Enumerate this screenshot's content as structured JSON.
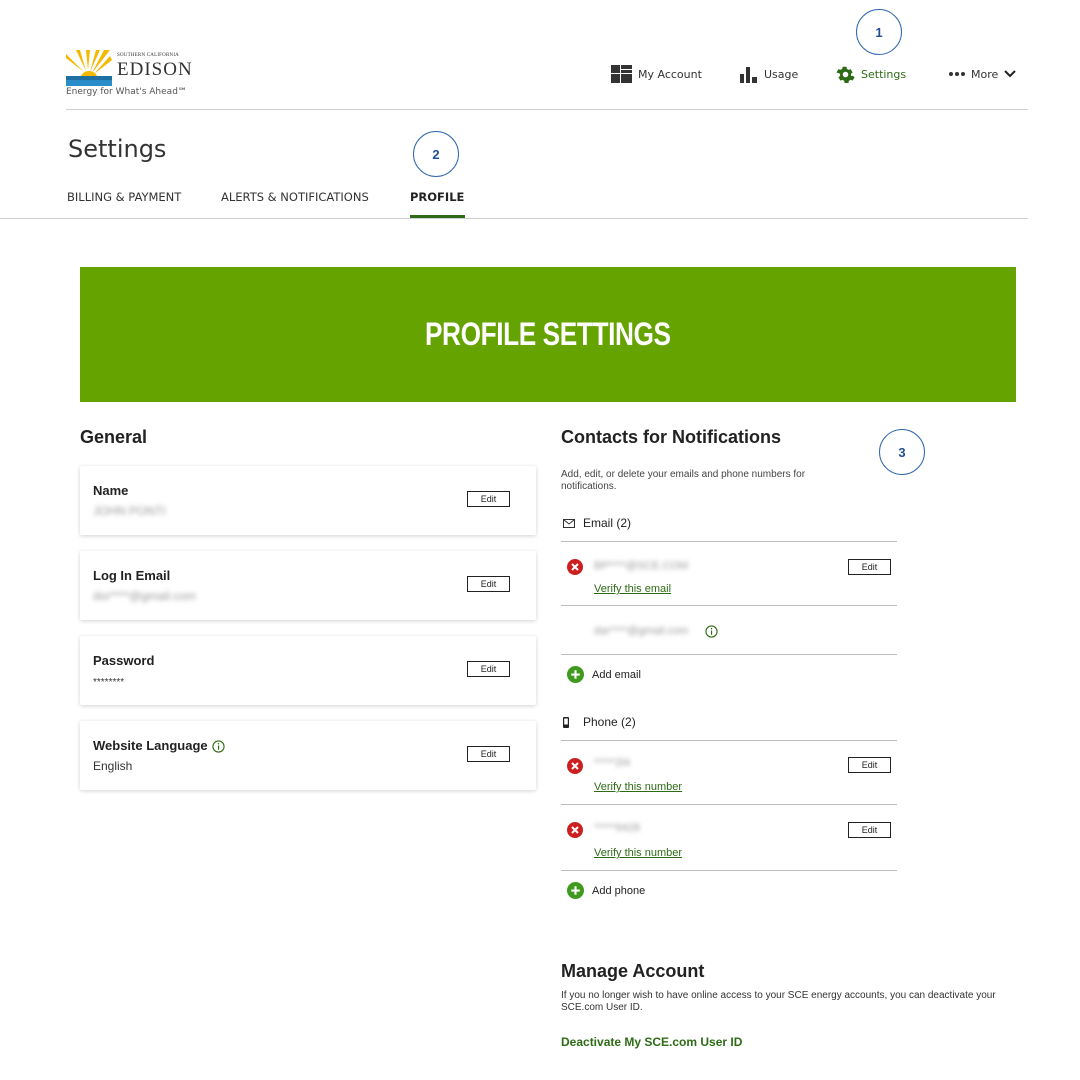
{
  "brand": {
    "small_text": "SOUTHERN CALIFORNIA",
    "name": "EDISON",
    "tagline": "Energy for What's Ahead℠",
    "colors": {
      "green": "#64a300",
      "dark_green": "#2e6b16",
      "yellow": "#f5b800",
      "callout_blue": "#2f67b1",
      "error_red": "#cc1f1f"
    }
  },
  "nav": [
    {
      "label": "My Account",
      "icon": "grid-icon"
    },
    {
      "label": "Usage",
      "icon": "bar-chart-icon"
    },
    {
      "label": "Settings",
      "icon": "gear-icon",
      "active": true
    },
    {
      "label": "More",
      "icon": "dots-icon"
    }
  ],
  "callouts": [
    "1",
    "2",
    "3"
  ],
  "page": {
    "title": "Settings",
    "tabs": [
      "BILLING & PAYMENT",
      "ALERTS & NOTIFICATIONS",
      "PROFILE"
    ],
    "active_tab": "PROFILE"
  },
  "banner": {
    "title": "PROFILE SETTINGS"
  },
  "general": {
    "title": "General",
    "edit_label": "Edit",
    "cards": [
      {
        "label": "Name",
        "value": "JOHN PONTI"
      },
      {
        "label": "Log In Email",
        "value": "dor****@gmail.com"
      },
      {
        "label": "Password",
        "value": "********"
      },
      {
        "label": "Website Language",
        "value": "English"
      }
    ]
  },
  "contacts": {
    "title": "Contacts for Notifications",
    "description": "Add, edit, or delete your emails and phone numbers for notifications.",
    "email_header": "Email (2)",
    "emails": [
      {
        "value": "BP****@SCE.COM",
        "verify": "Verify this email"
      },
      {
        "value": "dar****@gmail.com"
      }
    ],
    "add_email": "Add email",
    "phone_header": "Phone (2)",
    "phones": [
      {
        "value": "*****2l4",
        "verify": "Verify this number"
      },
      {
        "value": "*****9428",
        "verify": "Verify this number"
      }
    ],
    "add_phone": "Add phone"
  },
  "manage": {
    "title": "Manage Account",
    "description": "If you no longer wish to have online access to your SCE energy accounts, you can deactivate your SCE.com User ID.",
    "deactivate_label": "Deactivate My SCE.com User ID"
  }
}
